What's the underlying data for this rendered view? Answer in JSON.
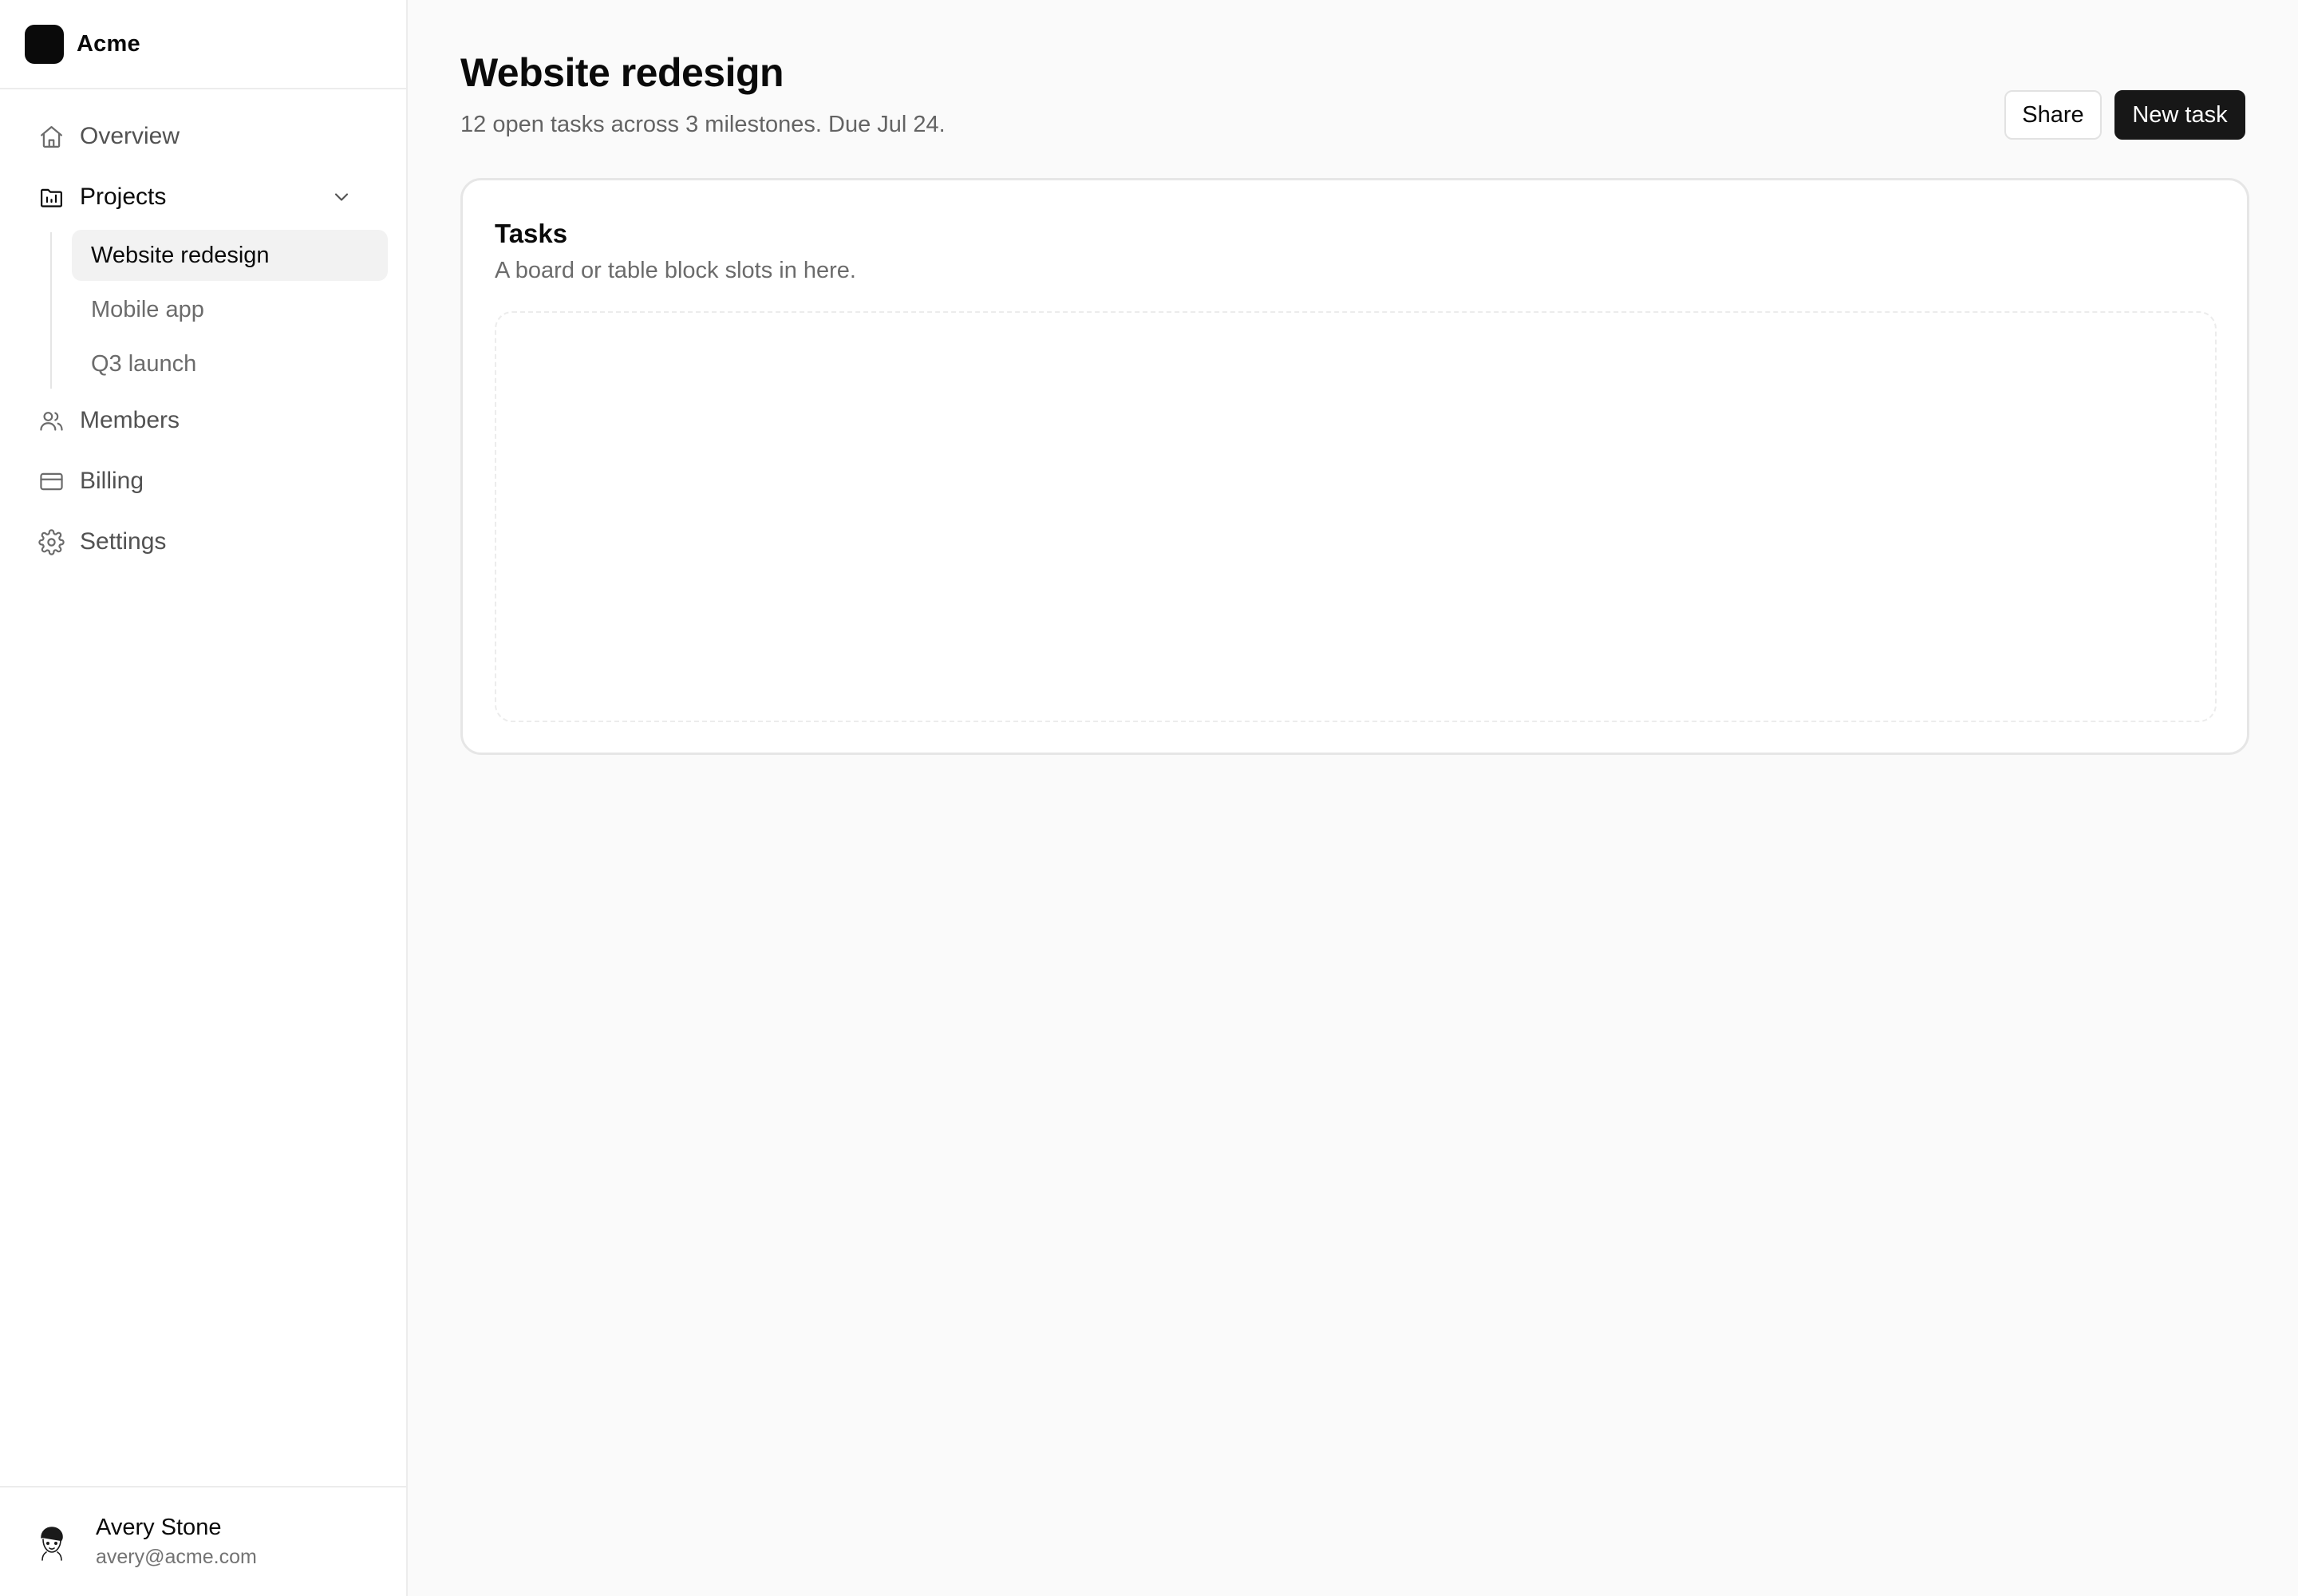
{
  "brand": {
    "name": "Acme"
  },
  "sidebar": {
    "nav": [
      {
        "label": "Overview",
        "icon": "home-icon"
      },
      {
        "label": "Projects",
        "icon": "folder-chart-icon",
        "expanded": true
      },
      {
        "label": "Members",
        "icon": "users-icon"
      },
      {
        "label": "Billing",
        "icon": "credit-card-icon"
      },
      {
        "label": "Settings",
        "icon": "gear-icon"
      }
    ],
    "projects": [
      {
        "label": "Website redesign",
        "selected": true
      },
      {
        "label": "Mobile app",
        "selected": false
      },
      {
        "label": "Q3 launch",
        "selected": false
      }
    ]
  },
  "user": {
    "name": "Avery Stone",
    "email": "avery@acme.com"
  },
  "page": {
    "title": "Website redesign",
    "subtitle": "12 open tasks across 3 milestones. Due Jul 24.",
    "actions": {
      "share_label": "Share",
      "new_task_label": "New task"
    }
  },
  "tasks_card": {
    "title": "Tasks",
    "description": "A board or table block slots in here."
  }
}
